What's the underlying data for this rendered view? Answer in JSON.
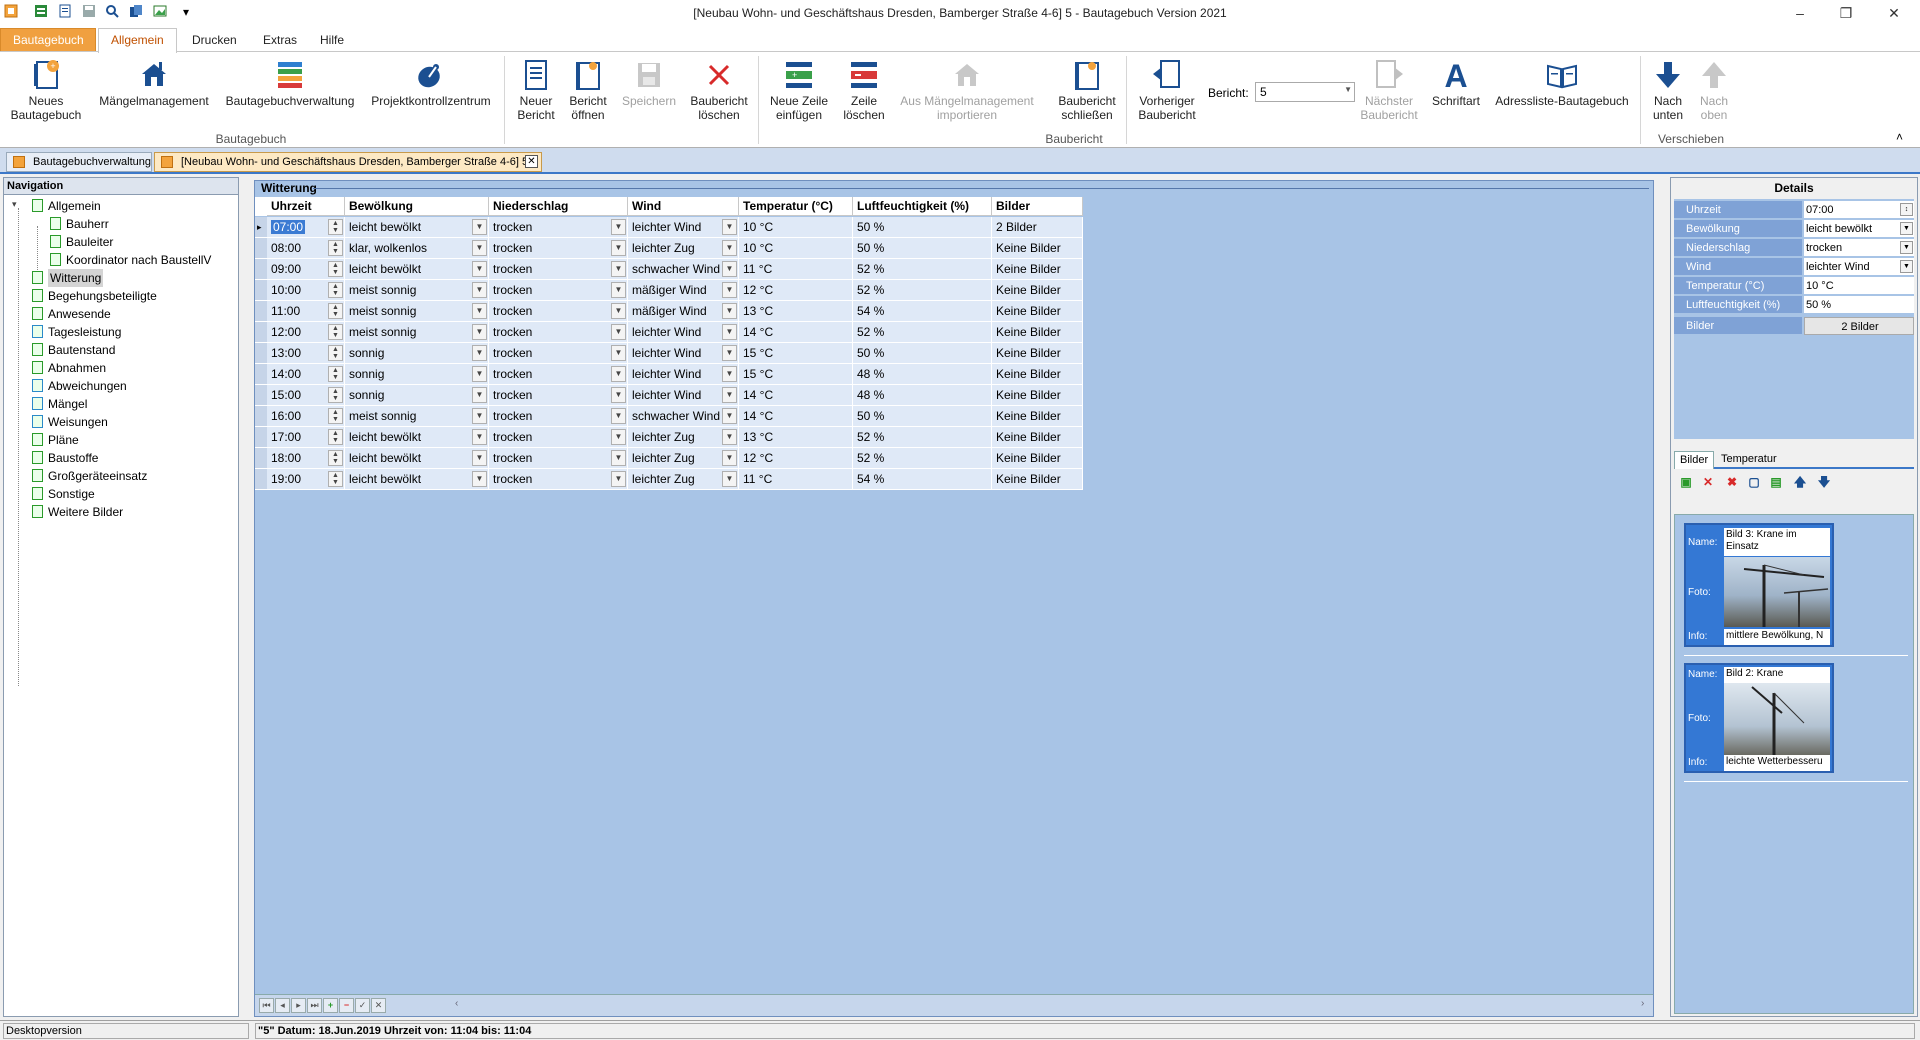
{
  "window": {
    "title": "[Neubau Wohn- und Geschäftshaus Dresden, Bamberger Straße 4-6] 5 - Bautagebuch Version 2021",
    "minimize": "–",
    "restore": "❐",
    "close": "✕",
    "quickaccess_more": "▾"
  },
  "ribbon_tabs": [
    "Bautagebuch",
    "Allgemein",
    "Drucken",
    "Extras",
    "Hilfe"
  ],
  "ribbon": {
    "groups": {
      "bautagebuch": "Bautagebuch",
      "baubericht": "Baubericht",
      "verschieben": "Verschieben"
    },
    "buttons": {
      "neues_bautagebuch": [
        "Neues",
        "Bautagebuch"
      ],
      "maengelmanagement": [
        "Mängelmanagement",
        ""
      ],
      "bautagebuchverwaltung": [
        "Bautagebuchverwaltung",
        ""
      ],
      "projektkontrollzentrum": [
        "Projektkontrollzentrum",
        ""
      ],
      "neuer_bericht": [
        "Neuer",
        "Bericht"
      ],
      "bericht_oeffnen": [
        "Bericht",
        "öffnen"
      ],
      "speichern": [
        "Speichern",
        ""
      ],
      "baubericht_loeschen": [
        "Baubericht",
        "löschen"
      ],
      "neue_zeile": [
        "Neue Zeile",
        "einfügen"
      ],
      "zeile_loeschen": [
        "Zeile",
        "löschen"
      ],
      "aus_maengel": [
        "Aus Mängelmanagement",
        "importieren"
      ],
      "baubericht_schliessen": [
        "Baubericht",
        "schließen"
      ],
      "vorheriger_baubericht": [
        "Vorheriger",
        "Baubericht"
      ],
      "naechster_baubericht": [
        "Nächster",
        "Baubericht"
      ],
      "schriftart": [
        "Schriftart",
        ""
      ],
      "adressliste": [
        "Adressliste-Bautagebuch",
        ""
      ],
      "nach_unten": [
        "Nach",
        "unten"
      ],
      "nach_oben": [
        "Nach",
        "oben"
      ]
    },
    "bericht_label": "Bericht:",
    "bericht_value": "5",
    "collapse": "˄"
  },
  "doc_tabs": [
    "Bautagebuchverwaltung",
    "[Neubau Wohn- und Geschäftshaus Dresden, Bamberger Straße 4-6] 5"
  ],
  "doc_tab_close": "✕",
  "navigation": {
    "header": "Navigation",
    "items": [
      "Allgemein",
      "Bauherr",
      "Bauleiter",
      "Koordinator nach BaustellV",
      "Witterung",
      "Begehungsbeteiligte",
      "Anwesende",
      "Tagesleistung",
      "Bautenstand",
      "Abnahmen",
      "Abweichungen",
      "Mängel",
      "Weisungen",
      "Pläne",
      "Baustoffe",
      "Großgeräteeinsatz",
      "Sonstige",
      "Weitere Bilder"
    ]
  },
  "main": {
    "title": "Witterung",
    "columns": [
      "Uhrzeit",
      "Bewölkung",
      "Niederschlag",
      "Wind",
      "Temperatur (°C)",
      "Luftfeuchtigkeit (%)",
      "Bilder"
    ],
    "rows": [
      [
        "07:00",
        "leicht bewölkt",
        "trocken",
        "leichter Wind",
        "10 °C",
        "50 %",
        "2 Bilder"
      ],
      [
        "08:00",
        "klar, wolkenlos",
        "trocken",
        "leichter Zug",
        "10 °C",
        "50 %",
        "Keine Bilder"
      ],
      [
        "09:00",
        "leicht bewölkt",
        "trocken",
        "schwacher Wind",
        "11 °C",
        "52 %",
        "Keine Bilder"
      ],
      [
        "10:00",
        "meist sonnig",
        "trocken",
        "mäßiger Wind",
        "12 °C",
        "52 %",
        "Keine Bilder"
      ],
      [
        "11:00",
        "meist sonnig",
        "trocken",
        "mäßiger Wind",
        "13 °C",
        "54 %",
        "Keine Bilder"
      ],
      [
        "12:00",
        "meist sonnig",
        "trocken",
        "leichter Wind",
        "14 °C",
        "52 %",
        "Keine Bilder"
      ],
      [
        "13:00",
        "sonnig",
        "trocken",
        "leichter Wind",
        "15 °C",
        "50 %",
        "Keine Bilder"
      ],
      [
        "14:00",
        "sonnig",
        "trocken",
        "leichter Wind",
        "15 °C",
        "48 %",
        "Keine Bilder"
      ],
      [
        "15:00",
        "sonnig",
        "trocken",
        "leichter Wind",
        "14 °C",
        "48 %",
        "Keine Bilder"
      ],
      [
        "16:00",
        "meist sonnig",
        "trocken",
        "schwacher Wind",
        "14 °C",
        "50 %",
        "Keine Bilder"
      ],
      [
        "17:00",
        "leicht bewölkt",
        "trocken",
        "leichter Zug",
        "13 °C",
        "52 %",
        "Keine Bilder"
      ],
      [
        "18:00",
        "leicht bewölkt",
        "trocken",
        "leichter Zug",
        "12 °C",
        "52 %",
        "Keine Bilder"
      ],
      [
        "19:00",
        "leicht bewölkt",
        "trocken",
        "leichter Zug",
        "11 °C",
        "54 %",
        "Keine Bilder"
      ]
    ]
  },
  "details": {
    "title": "Details",
    "fields": [
      [
        "Uhrzeit",
        "07:00"
      ],
      [
        "Bewölkung",
        "leicht bewölkt"
      ],
      [
        "Niederschlag",
        "trocken"
      ],
      [
        "Wind",
        "leichter Wind"
      ],
      [
        "Temperatur (°C)",
        "10 °C"
      ],
      [
        "Luftfeuchtigkeit (%)",
        "50 %"
      ],
      [
        "Bilder",
        "2 Bilder"
      ]
    ],
    "tabs": [
      "Bilder",
      "Temperatur"
    ],
    "photo_labels": {
      "name": "Name:",
      "foto": "Foto:",
      "info": "Info:"
    },
    "photos": [
      {
        "name": "Bild 3: Krane im Einsatz",
        "info": "mittlere Bewölkung, N"
      },
      {
        "name": "Bild 2: Krane",
        "info": "leichte Wetterbesseru"
      }
    ]
  },
  "status": {
    "left": "Desktopversion",
    "right": "\"5\" Datum: 18.Jun.2019 Uhrzeit von: 11:04 bis: 11:04"
  },
  "colors": {
    "accent_orange": "#f0a040",
    "grid_bg": "#a8c4e6",
    "selected_cell": "#3b7bd3"
  }
}
